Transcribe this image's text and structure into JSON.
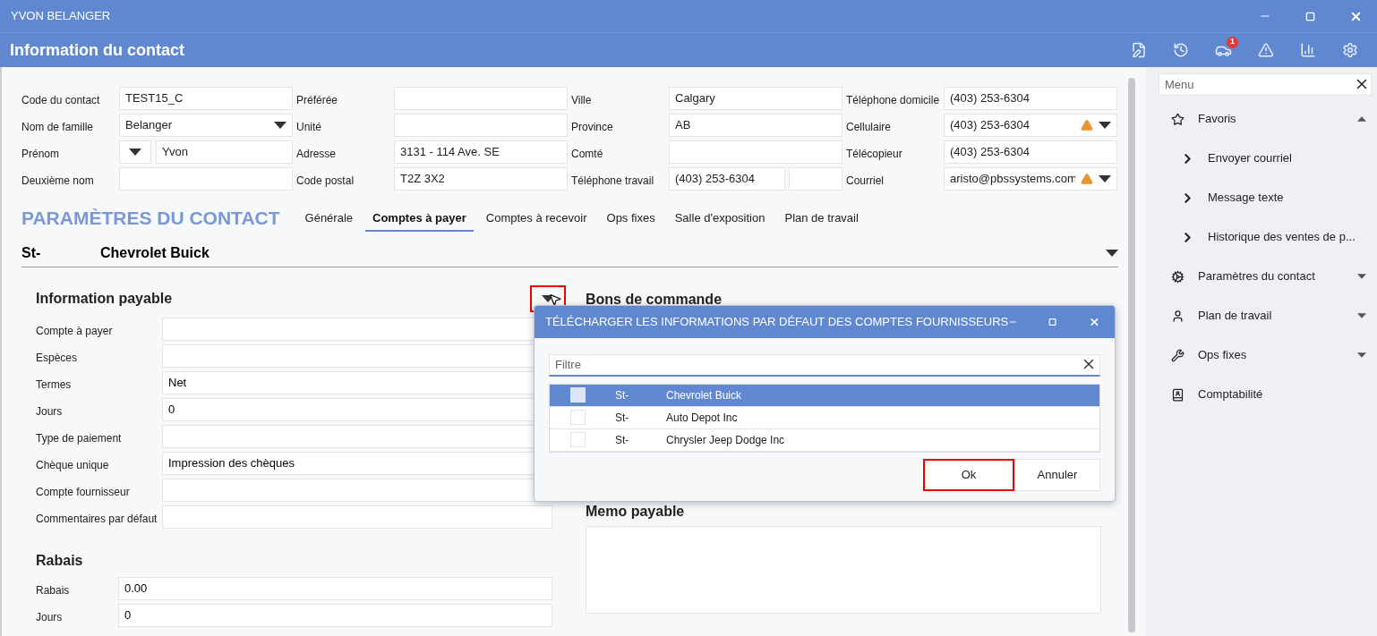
{
  "window": {
    "title": "YVON BELANGER"
  },
  "header": {
    "title": "Information du contact",
    "badge": "1"
  },
  "contact": {
    "rows": [
      [
        {
          "label": "Code du contact",
          "value": "TEST15_C",
          "kind": "text"
        },
        {
          "label": "Préférée",
          "kind": "text"
        },
        {
          "label": "Ville",
          "value": "Calgary",
          "kind": "text"
        },
        {
          "label": "Téléphone domicile",
          "value": "(403) 253-6304",
          "kind": "text"
        }
      ],
      [
        {
          "label": "Nom de famille",
          "value": "Belanger",
          "kind": "select"
        },
        {
          "label": "Unité",
          "kind": "text"
        },
        {
          "label": "Province",
          "value": "AB",
          "kind": "text"
        },
        {
          "label": "Cellulaire",
          "value": "(403) 253-6304",
          "kind": "alert_select"
        }
      ],
      [
        {
          "label": "Prénom",
          "value": "Yvon",
          "kind": "prefix_select"
        },
        {
          "label": "Adresse",
          "value": "3131 - 114 Ave. SE",
          "kind": "text"
        },
        {
          "label": "Comté",
          "kind": "text"
        },
        {
          "label": "Télécopieur",
          "value": "(403) 253-6304",
          "kind": "text"
        }
      ],
      [
        {
          "label": "Deuxième nom",
          "kind": "text"
        },
        {
          "label": "Code postal",
          "value": "T2Z 3X2",
          "kind": "text"
        },
        {
          "label": "Téléphone travail",
          "value": "(403) 253-6304",
          "kind": "split"
        },
        {
          "label": "Courriel",
          "value": "aristo@pbssystems.com",
          "kind": "alert_select"
        }
      ]
    ]
  },
  "settings": {
    "title": "PARAMÈTRES DU CONTACT",
    "tabs": [
      {
        "label": "Générale",
        "selected": false
      },
      {
        "label": "Comptes à payer",
        "selected": true
      },
      {
        "label": "Comptes à recevoir",
        "selected": false
      },
      {
        "label": "Ops fixes",
        "selected": false
      },
      {
        "label": "Salle d'exposition",
        "selected": false
      },
      {
        "label": "Plan de travail",
        "selected": false
      }
    ]
  },
  "account": {
    "code": "St-",
    "name": "Chevrolet Buick"
  },
  "payable": {
    "title": "Information payable",
    "fields": [
      {
        "label": "Compte à payer"
      },
      {
        "label": "Espèces"
      },
      {
        "label": "Termes",
        "value": "Net"
      },
      {
        "label": "Jours",
        "value": "0"
      },
      {
        "label": "Type de paiement"
      },
      {
        "label": "Chèque unique",
        "value": "Impression des chèques"
      },
      {
        "label": "Compte fournisseur"
      },
      {
        "label": "Commentaires par défaut"
      }
    ]
  },
  "rebates": {
    "title": "Rabais",
    "fields": [
      {
        "label": "Rabais",
        "value": "0.00"
      },
      {
        "label": "Jours",
        "value": "0"
      }
    ]
  },
  "orders": {
    "title": "Bons de commande",
    "dropdown_highlighted": true
  },
  "memo": {
    "title": "Memo payable"
  },
  "dialog": {
    "title": "TÉLÉCHARGER LES INFORMATIONS PAR DÉFAUT DES COMPTES FOURNISSEURS",
    "filter_placeholder": "Filtre",
    "rows": [
      {
        "code": "St-",
        "name": "Chevrolet Buick",
        "selected": true
      },
      {
        "code": "St-",
        "name": "Auto Depot Inc",
        "selected": false
      },
      {
        "code": "St-",
        "name": "Chrysler Jeep Dodge Inc",
        "selected": false
      }
    ],
    "buttons": [
      {
        "label": "Ok",
        "highlighted": true
      },
      {
        "label": "Annuler",
        "highlighted": false
      }
    ]
  },
  "sidebar": {
    "search_placeholder": "Menu",
    "items": [
      {
        "label": "Favoris",
        "expanded": true,
        "children": [
          {
            "label": "Envoyer courriel"
          },
          {
            "label": "Message texte"
          },
          {
            "label": "Historique des ventes de p..."
          }
        ]
      },
      {
        "label": "Paramètres du contact",
        "expanded": false
      },
      {
        "label": "Plan de travail",
        "expanded": false
      },
      {
        "label": "Ops fixes",
        "expanded": false
      },
      {
        "label": "Comptabilité"
      }
    ]
  }
}
